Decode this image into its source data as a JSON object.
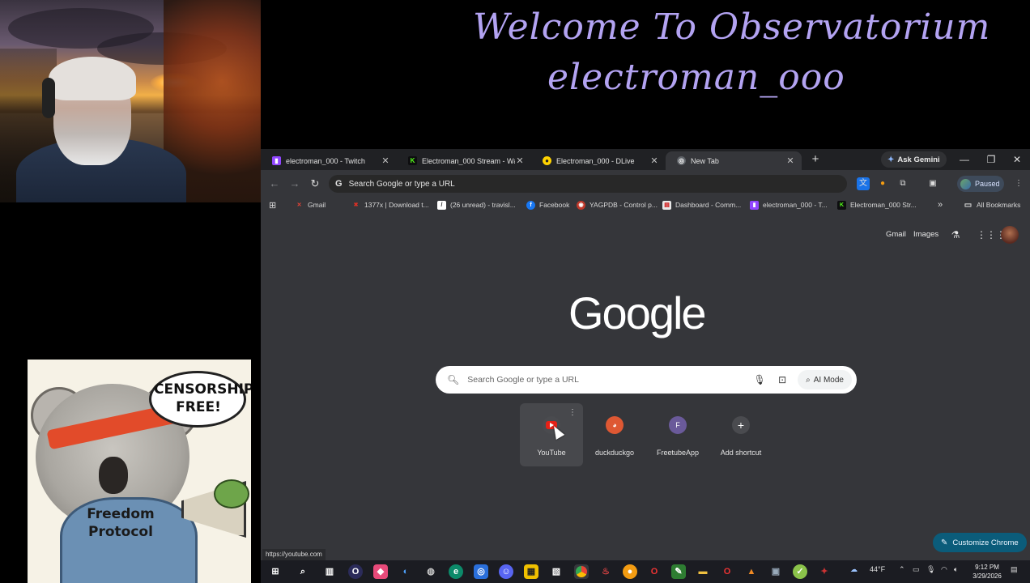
{
  "overlay": {
    "banner_line1": "Welcome To Observatorium",
    "banner_line2": "electroman_ooo",
    "meme_bubble": "CENSORSHIP FREE!",
    "meme_hoodie": "Freedom Protocol"
  },
  "browser": {
    "tabs": [
      {
        "title": "electroman_000 - Twitch",
        "icon": "twitch-icon",
        "color": "#9146ff"
      },
      {
        "title": "Electroman_000 Stream - Watch",
        "icon": "kick-icon",
        "color": "#53fc18"
      },
      {
        "title": "Electroman_000 - DLive",
        "icon": "dlive-icon",
        "color": "#ffd300"
      },
      {
        "title": "New Tab",
        "icon": "chrome-icon",
        "color": "#8ab4f8"
      }
    ],
    "ask_gemini": "Ask Gemini",
    "omnibox_text": "Search Google or type a URL",
    "profile_status": "Paused",
    "bookmarks": [
      {
        "label": "Gmail",
        "icon": "gmail-icon",
        "color": "#ea4335"
      },
      {
        "label": "1377x | Download t...",
        "icon": "x-icon",
        "color": "#d93025"
      },
      {
        "label": "(26 unread) - travisl...",
        "icon": "mail-icon",
        "color": "#ffffff"
      },
      {
        "label": "Facebook",
        "icon": "facebook-icon",
        "color": "#1877f2"
      },
      {
        "label": "YAGPDB - Control p...",
        "icon": "yagpdb-icon",
        "color": "#c0392b"
      },
      {
        "label": "Dashboard - Comm...",
        "icon": "dashboard-icon",
        "color": "#e8e8e8"
      },
      {
        "label": "electroman_000 - T...",
        "icon": "twitch-icon",
        "color": "#9146ff"
      },
      {
        "label": "Electroman_000 Str...",
        "icon": "kick-icon",
        "color": "#53fc18"
      }
    ],
    "all_bookmarks": "All Bookmarks",
    "ntp": {
      "gmail_link": "Gmail",
      "images_link": "Images",
      "logo": "Google",
      "search_placeholder": "Search Google or type a URL",
      "ai_mode": "AI Mode",
      "shortcuts": [
        {
          "label": "YouTube",
          "icon": "youtube-icon"
        },
        {
          "label": "duckduckgo",
          "icon": "duckduckgo-icon"
        },
        {
          "label": "FreetubeApp",
          "icon": "freetube-icon",
          "letter": "F"
        },
        {
          "label": "Add shortcut",
          "icon": "plus-icon",
          "glyph": "+"
        }
      ],
      "customize": "Customize Chrome",
      "status_url": "https://youtube.com"
    }
  },
  "taskbar": {
    "temperature": "44°F",
    "time": "9:12 PM",
    "date": "3/29/2026"
  }
}
